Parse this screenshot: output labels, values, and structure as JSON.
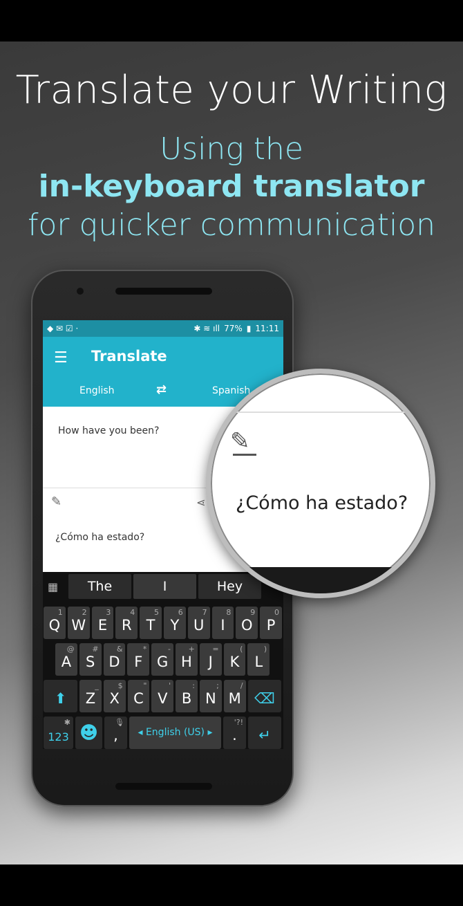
{
  "headline": "Translate your Writing",
  "sub1": "Using the",
  "sub2": "in-keyboard translator",
  "sub3": "for quicker communication",
  "status": {
    "battery": "77%",
    "time": "11:11"
  },
  "app": {
    "title": "Translate",
    "source_lang": "English",
    "target_lang": "Spanish",
    "input_text": "How have you been?",
    "output_text": "¿Cómo ha estado?"
  },
  "magnifier": {
    "text": "¿Cómo ha estado?"
  },
  "keyboard": {
    "suggestions": [
      "The",
      "I",
      "Hey"
    ],
    "row1": [
      [
        "Q",
        "1"
      ],
      [
        "W",
        "2"
      ],
      [
        "E",
        "3"
      ],
      [
        "R",
        "4"
      ],
      [
        "T",
        "5"
      ],
      [
        "Y",
        "6"
      ],
      [
        "U",
        "7"
      ],
      [
        "I",
        "8"
      ],
      [
        "O",
        "9"
      ],
      [
        "P",
        "0"
      ]
    ],
    "row2": [
      [
        "A",
        "@"
      ],
      [
        "S",
        "#"
      ],
      [
        "D",
        "&"
      ],
      [
        "F",
        "*"
      ],
      [
        "G",
        "-"
      ],
      [
        "H",
        "+"
      ],
      [
        "J",
        "="
      ],
      [
        "K",
        "("
      ],
      [
        "L",
        ")"
      ]
    ],
    "row3": [
      [
        "Z",
        "_"
      ],
      [
        "X",
        "$"
      ],
      [
        "C",
        "\""
      ],
      [
        "V",
        "'"
      ],
      [
        "B",
        ":"
      ],
      [
        "N",
        ";"
      ],
      [
        "M",
        "/"
      ]
    ],
    "num_label": "123",
    "comma": ",",
    "space_label": "English (US)",
    "period": ".",
    "period_sub": "'?!"
  },
  "colors": {
    "accent": "#22b2cb",
    "key_icon": "#3fd0ea"
  }
}
